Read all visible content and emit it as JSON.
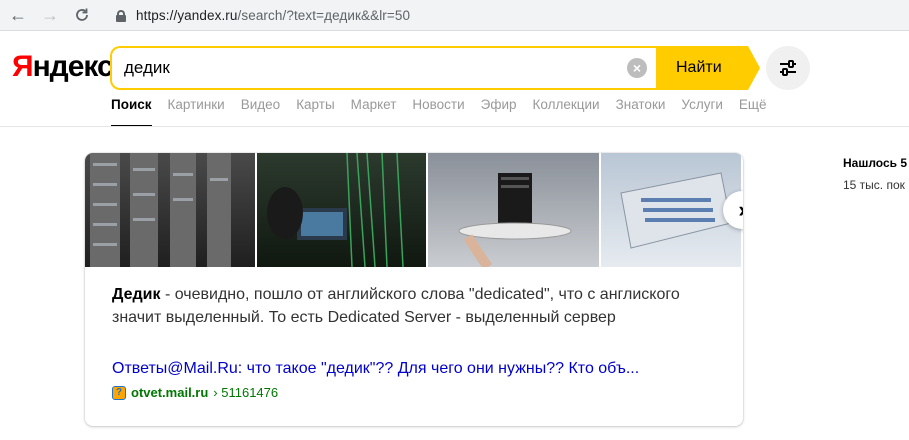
{
  "browser": {
    "url_main": "https://yandex.ru",
    "url_rest": "/search/?text=дедик&&lr=50"
  },
  "header": {
    "logo": "Яндекс",
    "search_value": "дедик",
    "search_button": "Найти"
  },
  "tabs": [
    {
      "label": "Поиск",
      "active": true
    },
    {
      "label": "Картинки"
    },
    {
      "label": "Видео"
    },
    {
      "label": "Карты"
    },
    {
      "label": "Маркет"
    },
    {
      "label": "Новости"
    },
    {
      "label": "Эфир"
    },
    {
      "label": "Коллекции"
    },
    {
      "label": "Знатоки"
    },
    {
      "label": "Услуги"
    },
    {
      "label": "Ещё"
    }
  ],
  "result": {
    "snippet_term": "Дедик",
    "snippet_text": " - очевидно, пошло от английского слова \"dedicated\", что с англиского значит выделенный. То есть Dedicated Server - выделенный сервер",
    "link_title": "Ответы@Mail.Ru: что такое \"дедик\"?? Для чего они нужны?? Кто объ...",
    "source_host": "otvet.mail.ru",
    "source_path": "› 51161476"
  },
  "sidebar": {
    "found": "Нашлось 5",
    "found_sub": "15 тыс. пок"
  },
  "colors": {
    "accent": "#ffcc00",
    "link": "#0000cc",
    "source": "#007700"
  }
}
